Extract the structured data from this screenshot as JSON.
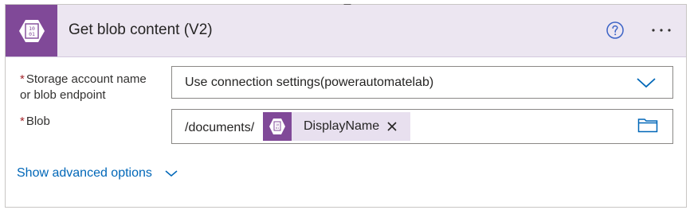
{
  "action": {
    "title": "Get blob content (V2)",
    "icon": "blob-storage-icon"
  },
  "header_icons": {
    "help": "help-circle-icon",
    "more": "ellipsis-icon"
  },
  "fields": [
    {
      "required_mark": "*",
      "label_line1": "Storage account name",
      "label_line2": "or blob endpoint",
      "value": "Use connection settings(powerautomatelab)"
    },
    {
      "required_mark": "*",
      "label_line1": "Blob",
      "path_prefix": "/documents/",
      "token_label": "DisplayName"
    }
  ],
  "advanced_options_label": "Show advanced options",
  "colors": {
    "accent": "#804998",
    "header_bg": "#ece6f1",
    "link": "#0067b8",
    "required": "#a4262c"
  }
}
